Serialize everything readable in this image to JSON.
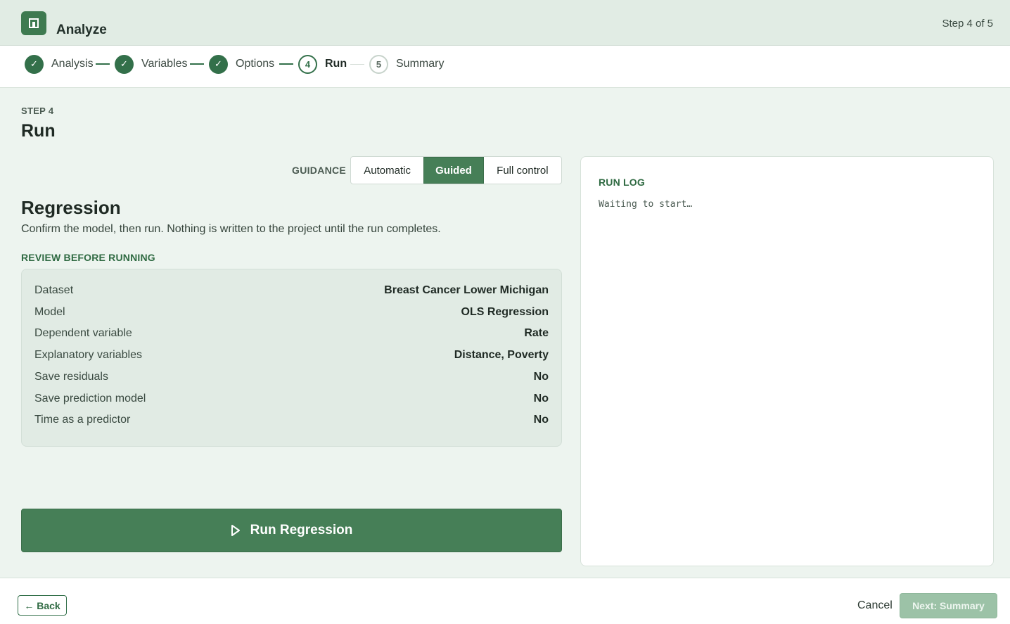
{
  "header": {
    "app_title": "Analyze",
    "step_counter": "Step 4 of 5",
    "logo_icon": "grid-square-icon"
  },
  "stepper": {
    "steps": [
      {
        "label": "Analysis",
        "number": "1",
        "state": "done"
      },
      {
        "label": "Variables",
        "number": "2",
        "state": "done"
      },
      {
        "label": "Options",
        "number": "3",
        "state": "done"
      },
      {
        "label": "Run",
        "number": "4",
        "state": "current"
      },
      {
        "label": "Summary",
        "number": "5",
        "state": "todo"
      }
    ],
    "check_glyph": "✓"
  },
  "page": {
    "eyebrow": "STEP 4",
    "title": "Run"
  },
  "guidance": {
    "label": "GUIDANCE",
    "options": [
      "Automatic",
      "Guided",
      "Full control"
    ],
    "selected": "Guided"
  },
  "section": {
    "title": "Regression",
    "description": "Confirm the model, then run. Nothing is written to the project until the run completes.",
    "review_label": "REVIEW BEFORE RUNNING"
  },
  "review": {
    "rows": [
      {
        "key": "Dataset",
        "value": "Breast Cancer Lower Michigan"
      },
      {
        "key": "Model",
        "value": "OLS Regression"
      },
      {
        "key": "Dependent variable",
        "value": "Rate"
      },
      {
        "key": "Explanatory variables",
        "value": "Distance, Poverty"
      },
      {
        "key": "Save residuals",
        "value": "No"
      },
      {
        "key": "Save prediction model",
        "value": "No"
      },
      {
        "key": "Time as a predictor",
        "value": "No"
      }
    ]
  },
  "run_button": {
    "label": "Run Regression",
    "icon": "play-icon"
  },
  "run_log": {
    "title": "RUN LOG",
    "text": "Waiting to start…"
  },
  "footer": {
    "back_label": "← Back",
    "cancel_label": "Cancel",
    "next_label": "Next: Summary"
  },
  "colors": {
    "accent": "#467f57",
    "accent_dark": "#33704a",
    "header_bg": "#e1ece4",
    "page_bg": "#edf4ef",
    "next_disabled": "#9cc2a7"
  }
}
